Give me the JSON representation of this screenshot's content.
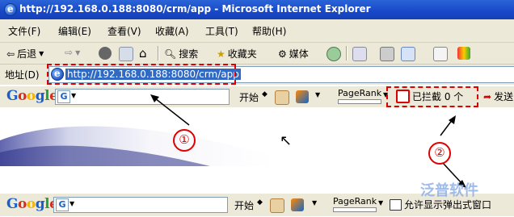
{
  "window": {
    "title": "http://192.168.0.188:8080/crm/app - Microsoft Internet Explorer"
  },
  "menu": [
    "文件(F)",
    "编辑(E)",
    "查看(V)",
    "收藏(A)",
    "工具(T)",
    "帮助(H)"
  ],
  "toolbar": {
    "back_label": "后退",
    "search_label": "搜索",
    "favorites_label": "收藏夹",
    "media_label": "媒体"
  },
  "address": {
    "label": "地址(D)",
    "url": "http://192.168.0.188:8080/crm/app"
  },
  "google_bar_top": {
    "logo": "Google",
    "start_label": "开始",
    "pagerank_label": "PageRank",
    "blocked_label": "已拦截 0 个",
    "send_label": "发送"
  },
  "google_bar_bottom": {
    "logo": "Google",
    "start_label": "开始",
    "pagerank_label": "PageRank",
    "allow_popup_label": "允许显示弹出式窗口"
  },
  "annotations": {
    "one": "①",
    "two": "②"
  },
  "watermark": "泛普软件",
  "colors": {
    "titlebar": "#1848c8",
    "toolbar_bg": "#ece9d8",
    "annotation_red": "#e00000",
    "selection": "#316ac5"
  }
}
